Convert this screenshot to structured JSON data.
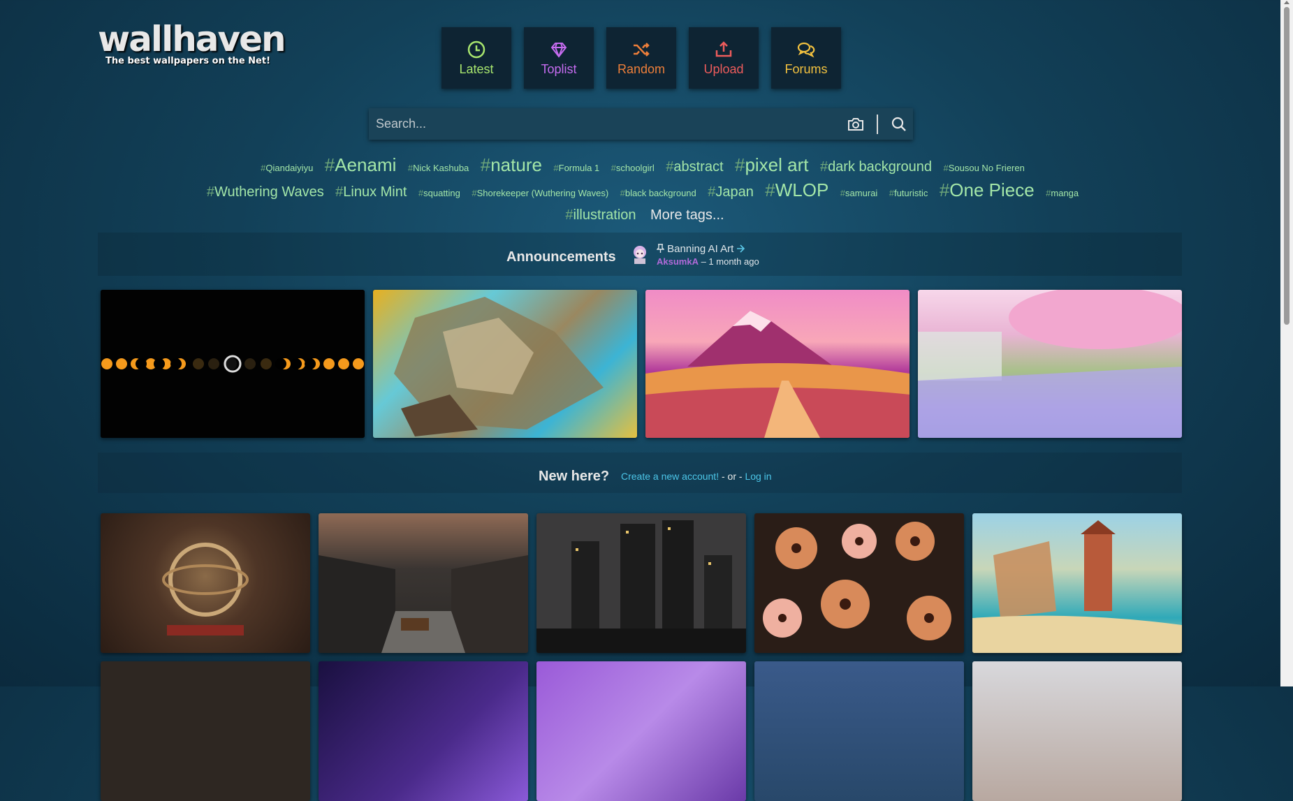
{
  "logo": {
    "name": "wallhaven",
    "tagline": "The best wallpapers on the Net!"
  },
  "nav": [
    {
      "label": "Latest",
      "icon": "clock-icon",
      "color": "#a8e66e"
    },
    {
      "label": "Toplist",
      "icon": "diamond-icon",
      "color": "#c66cf0"
    },
    {
      "label": "Random",
      "icon": "shuffle-icon",
      "color": "#ee7f3a"
    },
    {
      "label": "Upload",
      "icon": "upload-icon",
      "color": "#ee5c5c"
    },
    {
      "label": "Forums",
      "icon": "chat-icon",
      "color": "#f2c13f"
    }
  ],
  "search": {
    "placeholder": "Search...",
    "value": "",
    "camera_icon": "camera-icon",
    "search_icon": "search-icon"
  },
  "tags": {
    "rows": [
      [
        {
          "label": "Qiandaiyiyu",
          "size": "s1"
        },
        {
          "label": "Aenami",
          "size": "s3"
        },
        {
          "label": "Nick Kashuba",
          "size": "s1"
        },
        {
          "label": "nature",
          "size": "s3"
        },
        {
          "label": "Formula 1",
          "size": "s1"
        },
        {
          "label": "schoolgirl",
          "size": "s1"
        },
        {
          "label": "abstract",
          "size": "s2"
        },
        {
          "label": "pixel art",
          "size": "s3"
        },
        {
          "label": "dark background",
          "size": "s2"
        },
        {
          "label": "Sousou No Frieren",
          "size": "s1"
        }
      ],
      [
        {
          "label": "Wuthering Waves",
          "size": "s2"
        },
        {
          "label": "Linux Mint",
          "size": "s2"
        },
        {
          "label": "squatting",
          "size": "s1"
        },
        {
          "label": "Shorekeeper (Wuthering Waves)",
          "size": "s1"
        },
        {
          "label": "black background",
          "size": "s1"
        },
        {
          "label": "Japan",
          "size": "s2"
        },
        {
          "label": "WLOP",
          "size": "s3"
        },
        {
          "label": "samurai",
          "size": "s1"
        },
        {
          "label": "futuristic",
          "size": "s1"
        },
        {
          "label": "One Piece",
          "size": "s3"
        },
        {
          "label": "manga",
          "size": "s1"
        }
      ],
      [
        {
          "label": "illustration",
          "size": "s2"
        }
      ]
    ],
    "more": "More tags..."
  },
  "announcements": {
    "title": "Announcements",
    "pin_icon": "pin-icon",
    "headline": "Banning AI Art",
    "arrow_icon": "arrow-right-icon",
    "user": "AksumkA",
    "time": " – 1 month ago"
  },
  "featured": [
    "eclipse",
    "island",
    "mountain",
    "sakura"
  ],
  "welcome": {
    "title": "New here?",
    "create": "Create a new account!",
    "or": " - or - ",
    "login": "Log in"
  },
  "grid": [
    "orrery",
    "canal",
    "city",
    "flowers",
    "tropical",
    "dark",
    "space",
    "purple",
    "blue-town",
    "sky"
  ],
  "colors": {
    "tag": "#a3e6a8",
    "link": "#4cc6e8",
    "user": "#b06ad8"
  }
}
